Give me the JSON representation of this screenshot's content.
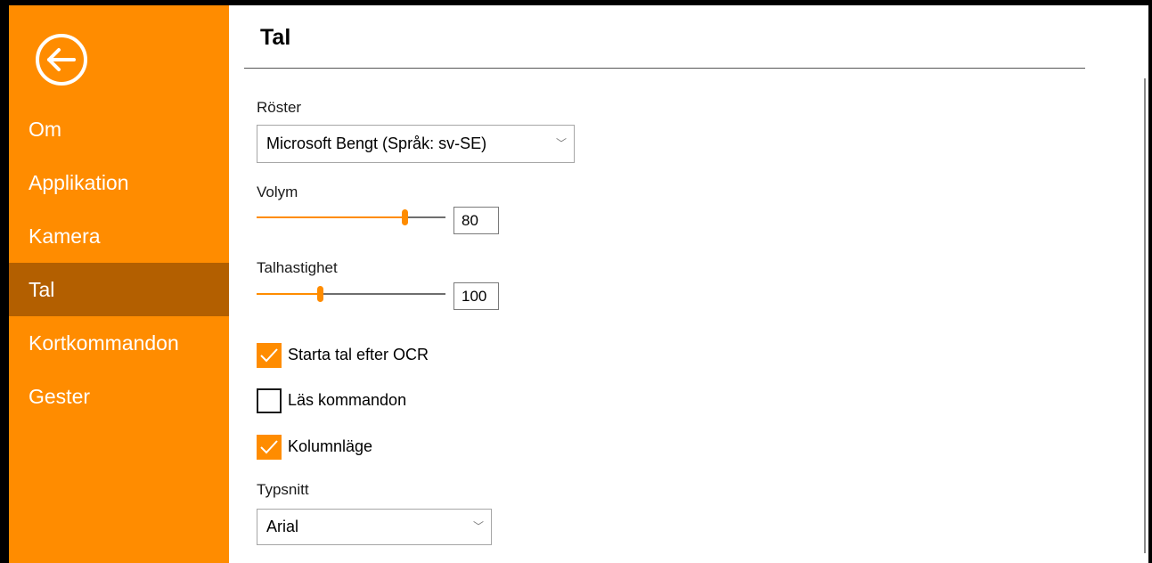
{
  "colors": {
    "accent": "#ff8c00",
    "active_nav": "#b35f00"
  },
  "sidebar": {
    "back_icon": "back-arrow-circle-icon",
    "items": [
      {
        "label": "Om"
      },
      {
        "label": "Applikation"
      },
      {
        "label": "Kamera"
      },
      {
        "label": "Tal",
        "active": true
      },
      {
        "label": "Kortkommandon"
      },
      {
        "label": "Gester"
      }
    ]
  },
  "page": {
    "title": "Tal"
  },
  "voices": {
    "label": "Röster",
    "value": "Microsoft Bengt (Språk: sv-SE)"
  },
  "volume": {
    "label": "Volym",
    "value": "80"
  },
  "speed": {
    "label": "Talhastighet",
    "value": "100"
  },
  "options": {
    "start_speech": {
      "label": "Starta tal efter OCR",
      "checked": true
    },
    "read_commands": {
      "label": "Läs kommandon",
      "checked": false
    },
    "column_mode": {
      "label": "Kolumnläge",
      "checked": true
    }
  },
  "font": {
    "label": "Typsnitt",
    "value": "Arial"
  }
}
